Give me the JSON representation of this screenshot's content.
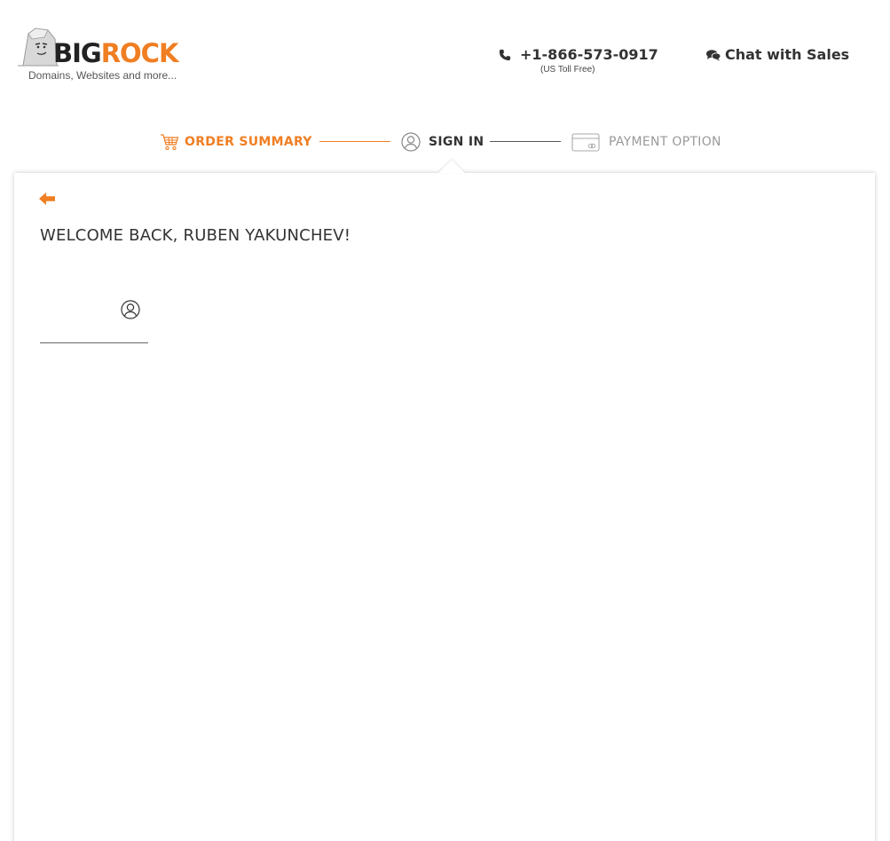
{
  "brand": {
    "name_part1": "BIG",
    "name_part2": "ROCK",
    "tagline": "Domains, Websites and more...",
    "colors": {
      "accent": "#f07e22",
      "dark": "#222222"
    }
  },
  "header": {
    "phone": {
      "number": "+1-866-573-0917",
      "note": "(US Toll Free)",
      "icon": "phone-icon"
    },
    "chat": {
      "label": "Chat with Sales",
      "icon": "chat-bubbles-icon"
    }
  },
  "steps": [
    {
      "label": "ORDER SUMMARY",
      "icon": "cart-icon",
      "state": "completed"
    },
    {
      "label": "SIGN IN",
      "icon": "user-circle-icon",
      "state": "current"
    },
    {
      "label": "PAYMENT OPTION",
      "icon": "credit-card-icon",
      "state": "upcoming"
    }
  ],
  "card": {
    "back_icon": "arrow-left-icon",
    "welcome": "WELCOME BACK, RUBEN YAKUNCHEV!",
    "user_field": {
      "value": "",
      "icon": "user-circle-icon"
    }
  }
}
